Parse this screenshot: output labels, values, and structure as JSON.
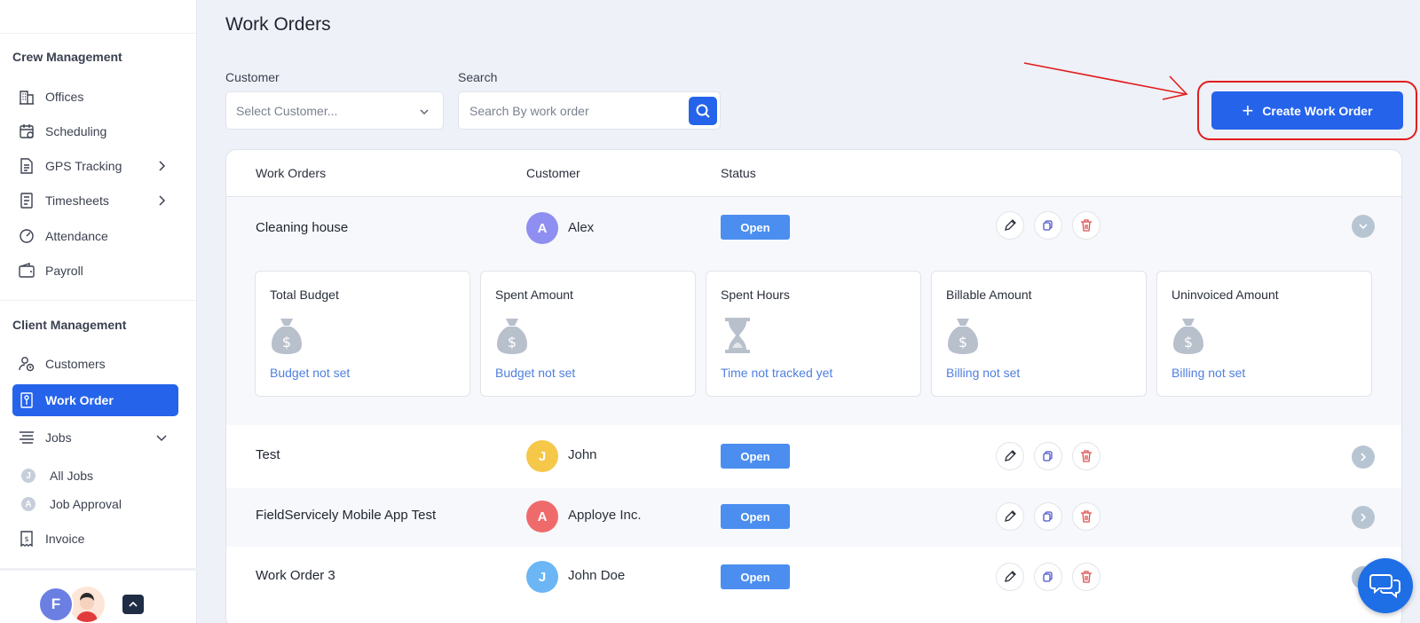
{
  "sidebar": {
    "crew_section": "Crew Management",
    "crew_items": [
      {
        "label": "Offices",
        "icon": "building-icon"
      },
      {
        "label": "Scheduling",
        "icon": "calendar-icon"
      },
      {
        "label": "GPS Tracking",
        "icon": "document-icon",
        "has_chevron": true
      },
      {
        "label": "Timesheets",
        "icon": "timesheet-icon",
        "has_chevron": true
      },
      {
        "label": "Attendance",
        "icon": "gauge-icon"
      },
      {
        "label": "Payroll",
        "icon": "wallet-icon"
      }
    ],
    "client_section": "Client Management",
    "client_items": [
      {
        "label": "Customers",
        "icon": "user-clock-icon"
      },
      {
        "label": "Work Order",
        "icon": "work-order-icon",
        "active": true
      },
      {
        "label": "Jobs",
        "icon": "list-icon",
        "expanded": true
      }
    ],
    "job_subitems": [
      {
        "label": "All Jobs",
        "letter": "J"
      },
      {
        "label": "Job Approval",
        "letter": "A"
      }
    ],
    "invoice_label": "Invoice",
    "user_initial": "F"
  },
  "main": {
    "title": "Work Orders",
    "customer_label": "Customer",
    "customer_placeholder": "Select Customer...",
    "search_label": "Search",
    "search_placeholder": "Search By work order",
    "create_button": "Create Work Order",
    "plus_glyph": "+"
  },
  "table": {
    "headers": [
      "Work Orders",
      "Customer",
      "Status"
    ],
    "rows": [
      {
        "name": "Cleaning house",
        "initial": "A",
        "customer": "Alex",
        "avatar_color": "#8f8ff2",
        "status": "Open",
        "expanded": true
      },
      {
        "name": "Test",
        "initial": "J",
        "customer": "John",
        "avatar_color": "#f5c84a",
        "status": "Open"
      },
      {
        "name": "FieldServicely Mobile App Test",
        "initial": "A",
        "customer": "Apploye Inc.",
        "avatar_color": "#ef6b6b",
        "status": "Open"
      },
      {
        "name": "Work Order 3",
        "initial": "J",
        "customer": "John Doe",
        "avatar_color": "#6cb6f5",
        "status": "Open"
      }
    ],
    "summary": [
      {
        "title": "Total Budget",
        "value": "Budget not set",
        "icon": "money-bag-icon"
      },
      {
        "title": "Spent Amount",
        "value": "Budget not set",
        "icon": "money-bag-icon"
      },
      {
        "title": "Spent Hours",
        "value": "Time not tracked yet",
        "icon": "hourglass-icon"
      },
      {
        "title": "Billable Amount",
        "value": "Billing not set",
        "icon": "money-bag-icon"
      },
      {
        "title": "Uninvoiced Amount",
        "value": "Billing not set",
        "icon": "money-bag-icon"
      }
    ]
  },
  "colors": {
    "accent": "#2563eb",
    "status_open": "#4b8ef0",
    "highlight": "#e11d1d",
    "link": "#4f7fe0"
  }
}
